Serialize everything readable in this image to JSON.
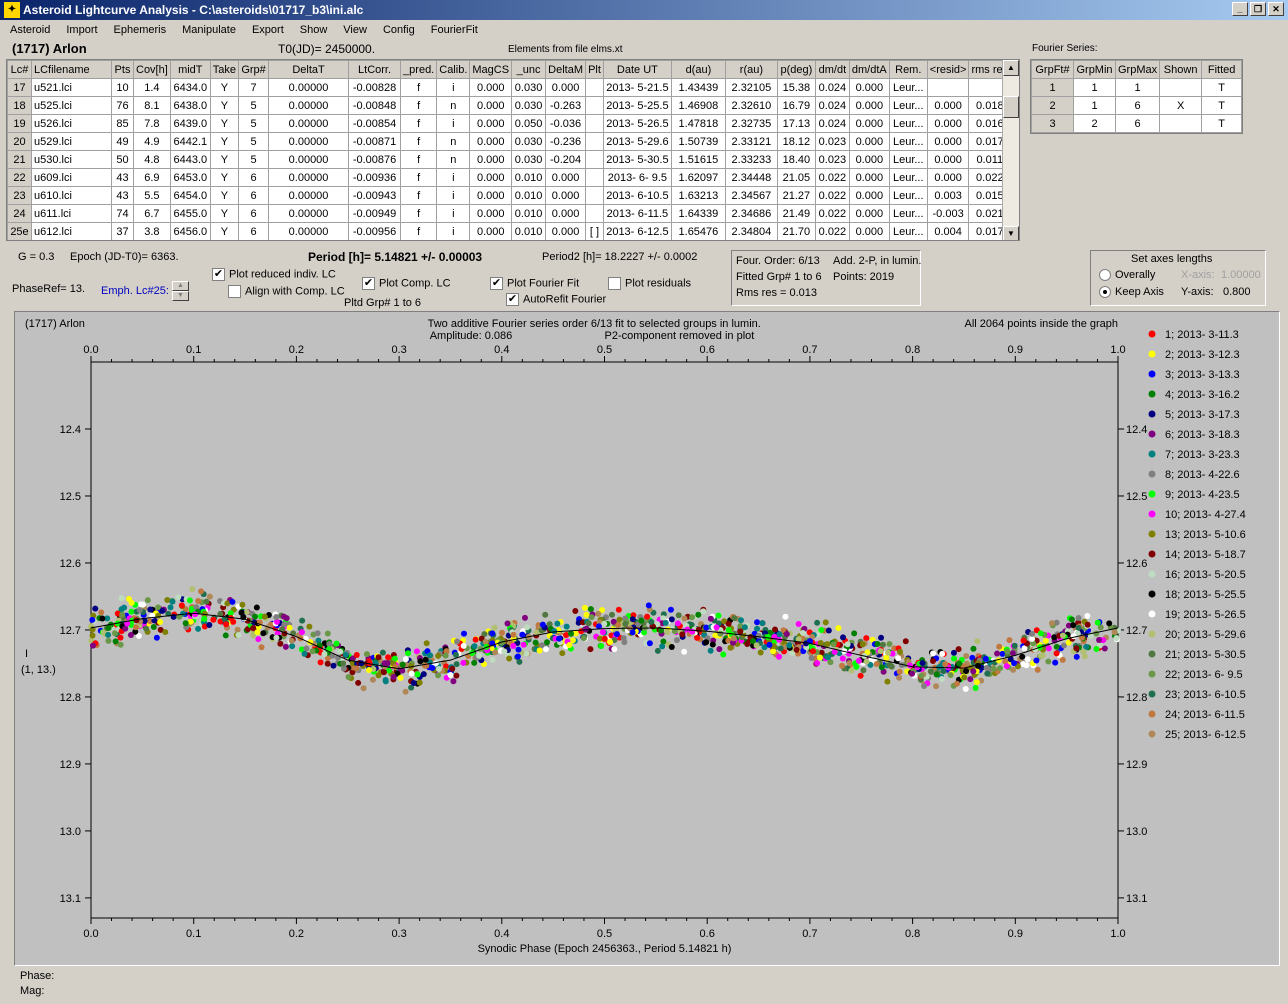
{
  "window": {
    "title": "Asteroid Lightcurve Analysis - C:\\asteroids\\01717_b3\\ini.alc",
    "icon": "asteroid-app-icon",
    "minimize": "_",
    "restore": "❐",
    "close": "✕"
  },
  "menu": [
    "Asteroid",
    "Import",
    "Ephemeris",
    "Manipulate",
    "Export",
    "Show",
    "View",
    "Config",
    "FourierFit"
  ],
  "header": {
    "asteroid": "(1717) Arlon",
    "t0": "T0(JD)= 2450000.",
    "elements": "Elements from file elms.xt"
  },
  "lc_table": {
    "columns": [
      "Lc#",
      "LCfilename",
      "Pts",
      "Cov[h]",
      "midT",
      "Take",
      "Grp#",
      "DeltaT",
      "LtCorr.",
      "_pred.",
      "Calib.",
      "MagCS",
      "_unc",
      "DeltaM",
      "Plt",
      "Date UT",
      "d(au)",
      "r(au)",
      "p(deg)",
      "dm/dt",
      "dm/dtA",
      "Rem.",
      "<resid>",
      "rms res"
    ],
    "rows": [
      [
        "17",
        "u521.lci",
        "10",
        "1.4",
        "6434.0",
        "Y",
        "7",
        "0.00000",
        "-0.00828",
        "f",
        "i",
        "0.000",
        "0.030",
        "0.000",
        "",
        "2013- 5-21.5",
        "1.43439",
        "2.32105",
        "15.38",
        "0.024",
        "0.000",
        "Leur...",
        "",
        ""
      ],
      [
        "18",
        "u525.lci",
        "76",
        "8.1",
        "6438.0",
        "Y",
        "5",
        "0.00000",
        "-0.00848",
        "f",
        "n",
        "0.000",
        "0.030",
        "-0.263",
        "",
        "2013- 5-25.5",
        "1.46908",
        "2.32610",
        "16.79",
        "0.024",
        "0.000",
        "Leur...",
        "0.000",
        "0.018"
      ],
      [
        "19",
        "u526.lci",
        "85",
        "7.8",
        "6439.0",
        "Y",
        "5",
        "0.00000",
        "-0.00854",
        "f",
        "i",
        "0.000",
        "0.050",
        "-0.036",
        "",
        "2013- 5-26.5",
        "1.47818",
        "2.32735",
        "17.13",
        "0.024",
        "0.000",
        "Leur...",
        "0.000",
        "0.016"
      ],
      [
        "20",
        "u529.lci",
        "49",
        "4.9",
        "6442.1",
        "Y",
        "5",
        "0.00000",
        "-0.00871",
        "f",
        "n",
        "0.000",
        "0.030",
        "-0.236",
        "",
        "2013- 5-29.6",
        "1.50739",
        "2.33121",
        "18.12",
        "0.023",
        "0.000",
        "Leur...",
        "0.000",
        "0.017"
      ],
      [
        "21",
        "u530.lci",
        "50",
        "4.8",
        "6443.0",
        "Y",
        "5",
        "0.00000",
        "-0.00876",
        "f",
        "n",
        "0.000",
        "0.030",
        "-0.204",
        "",
        "2013- 5-30.5",
        "1.51615",
        "2.33233",
        "18.40",
        "0.023",
        "0.000",
        "Leur...",
        "0.000",
        "0.011"
      ],
      [
        "22",
        "u609.lci",
        "43",
        "6.9",
        "6453.0",
        "Y",
        "6",
        "0.00000",
        "-0.00936",
        "f",
        "i",
        "0.000",
        "0.010",
        "0.000",
        "",
        "2013- 6- 9.5",
        "1.62097",
        "2.34448",
        "21.05",
        "0.022",
        "0.000",
        "Leur...",
        "0.000",
        "0.022"
      ],
      [
        "23",
        "u610.lci",
        "43",
        "5.5",
        "6454.0",
        "Y",
        "6",
        "0.00000",
        "-0.00943",
        "f",
        "i",
        "0.000",
        "0.010",
        "0.000",
        "",
        "2013- 6-10.5",
        "1.63213",
        "2.34567",
        "21.27",
        "0.022",
        "0.000",
        "Leur...",
        "0.003",
        "0.015"
      ],
      [
        "24",
        "u611.lci",
        "74",
        "6.7",
        "6455.0",
        "Y",
        "6",
        "0.00000",
        "-0.00949",
        "f",
        "i",
        "0.000",
        "0.010",
        "0.000",
        "",
        "2013- 6-11.5",
        "1.64339",
        "2.34686",
        "21.49",
        "0.022",
        "0.000",
        "Leur...",
        "-0.003",
        "0.021"
      ],
      [
        "25e",
        "u612.lci",
        "37",
        "3.8",
        "6456.0",
        "Y",
        "6",
        "0.00000",
        "-0.00956",
        "f",
        "i",
        "0.000",
        "0.010",
        "0.000",
        "[ ]",
        "2013- 6-12.5",
        "1.65476",
        "2.34804",
        "21.70",
        "0.022",
        "0.000",
        "Leur...",
        "0.004",
        "0.017"
      ]
    ]
  },
  "fourier_table": {
    "title": "Fourier Series:",
    "columns": [
      "GrpFt#",
      "GrpMin",
      "GrpMax",
      "Shown",
      "Fitted"
    ],
    "rows": [
      [
        "1",
        "1",
        "1",
        "",
        "T"
      ],
      [
        "2",
        "1",
        "6",
        "X",
        "T"
      ],
      [
        "3",
        "2",
        "6",
        "",
        "T"
      ]
    ]
  },
  "controls": {
    "g": "G = 0.3",
    "epoch": "Epoch (JD-T0)= 6363.",
    "period": "Period [h]= 5.14821 +/- 0.00003",
    "period2": "Period2 [h]= 18.2227 +/- 0.0002",
    "phaseref": "PhaseRef= 13.",
    "emph": "Emph. Lc#25:",
    "plot_reduced": "Plot reduced indiv. LC",
    "align": "Align with Comp. LC",
    "plot_comp": "Plot Comp. LC",
    "pltd_grp": "Pltd Grp#  1   to   6",
    "plot_fourier": "Plot Fourier Fit",
    "autorefit": "AutoRefit Fourier",
    "plot_residuals": "Plot residuals"
  },
  "info_box": {
    "order": "Four. Order:  6/13",
    "add": "Add. 2-P, in lumin.",
    "fitted": "Fitted Grp# 1 to 6",
    "points": "Points: 2019",
    "rms": "Rms res     = 0.013"
  },
  "axes_box": {
    "title": "Set axes lengths",
    "overally": "Overally",
    "keep": "Keep Axis",
    "xlabel": "X-axis:",
    "xval": "1.00000",
    "ylabel": "Y-axis:",
    "yval": "0.800"
  },
  "status": {
    "phase": "Phase:",
    "mag": "Mag:"
  },
  "chart_data": {
    "type": "scatter",
    "title": "Two additive Fourier series order 6/13 fit to selected groups in lumin.",
    "amplitude": "Amplitude: 0.086",
    "note": "P2-component removed in plot",
    "corner_left": "(1717) Arlon",
    "corner_right": "All 2064 points inside the graph",
    "xlabel": "Synodic Phase (Epoch 2456363., Period 5.14821 h)",
    "ylabel": "I",
    "ylabel2": "(1, 13.)",
    "xlim": [
      0,
      1
    ],
    "ylim": [
      12.3,
      13.13
    ],
    "y_inverted": true,
    "xticks": [
      "0.0",
      "0.1",
      "0.2",
      "0.3",
      "0.4",
      "0.5",
      "0.6",
      "0.7",
      "0.8",
      "0.9",
      "1.0"
    ],
    "yticks": [
      "12.4",
      "12.5",
      "12.6",
      "12.7",
      "12.8",
      "12.9",
      "13.0",
      "13.1"
    ],
    "fit_curve": {
      "x": [
        0,
        0.05,
        0.1,
        0.15,
        0.2,
        0.25,
        0.3,
        0.35,
        0.4,
        0.45,
        0.5,
        0.55,
        0.6,
        0.65,
        0.7,
        0.75,
        0.8,
        0.85,
        0.9,
        0.95,
        1.0
      ],
      "y": [
        12.697,
        12.683,
        12.675,
        12.684,
        12.71,
        12.745,
        12.758,
        12.745,
        12.718,
        12.703,
        12.698,
        12.697,
        12.702,
        12.71,
        12.72,
        12.738,
        12.755,
        12.757,
        12.738,
        12.713,
        12.697
      ]
    },
    "legend": [
      {
        "label": "1; 2013- 3-11.3",
        "color": "#ff0000"
      },
      {
        "label": "2; 2013- 3-12.3",
        "color": "#ffff00"
      },
      {
        "label": "3; 2013- 3-13.3",
        "color": "#0000ff"
      },
      {
        "label": "4; 2013- 3-16.2",
        "color": "#008000"
      },
      {
        "label": "5; 2013- 3-17.3",
        "color": "#000080"
      },
      {
        "label": "6; 2013- 3-18.3",
        "color": "#800080"
      },
      {
        "label": "7; 2013- 3-23.3",
        "color": "#008080"
      },
      {
        "label": "8; 2013- 4-22.6",
        "color": "#808080"
      },
      {
        "label": "9; 2013- 4-23.5",
        "color": "#00ff00"
      },
      {
        "label": "10; 2013- 4-27.4",
        "color": "#ff00ff"
      },
      {
        "label": "13; 2013- 5-10.6",
        "color": "#808000"
      },
      {
        "label": "14; 2013- 5-18.7",
        "color": "#800000"
      },
      {
        "label": "16; 2013- 5-20.5",
        "color": "#c0dcc0"
      },
      {
        "label": "18; 2013- 5-25.5",
        "color": "#000000"
      },
      {
        "label": "19; 2013- 5-26.5",
        "color": "#ffffff"
      },
      {
        "label": "20; 2013- 5-29.6",
        "color": "#b0c070"
      },
      {
        "label": "21; 2013- 5-30.5",
        "color": "#507840"
      },
      {
        "label": "22; 2013- 6- 9.5",
        "color": "#6a9848"
      },
      {
        "label": "23; 2013- 6-10.5",
        "color": "#207050"
      },
      {
        "label": "24; 2013- 6-11.5",
        "color": "#c07840"
      },
      {
        "label": "25; 2013- 6-12.5",
        "color": "#b08858"
      }
    ]
  }
}
